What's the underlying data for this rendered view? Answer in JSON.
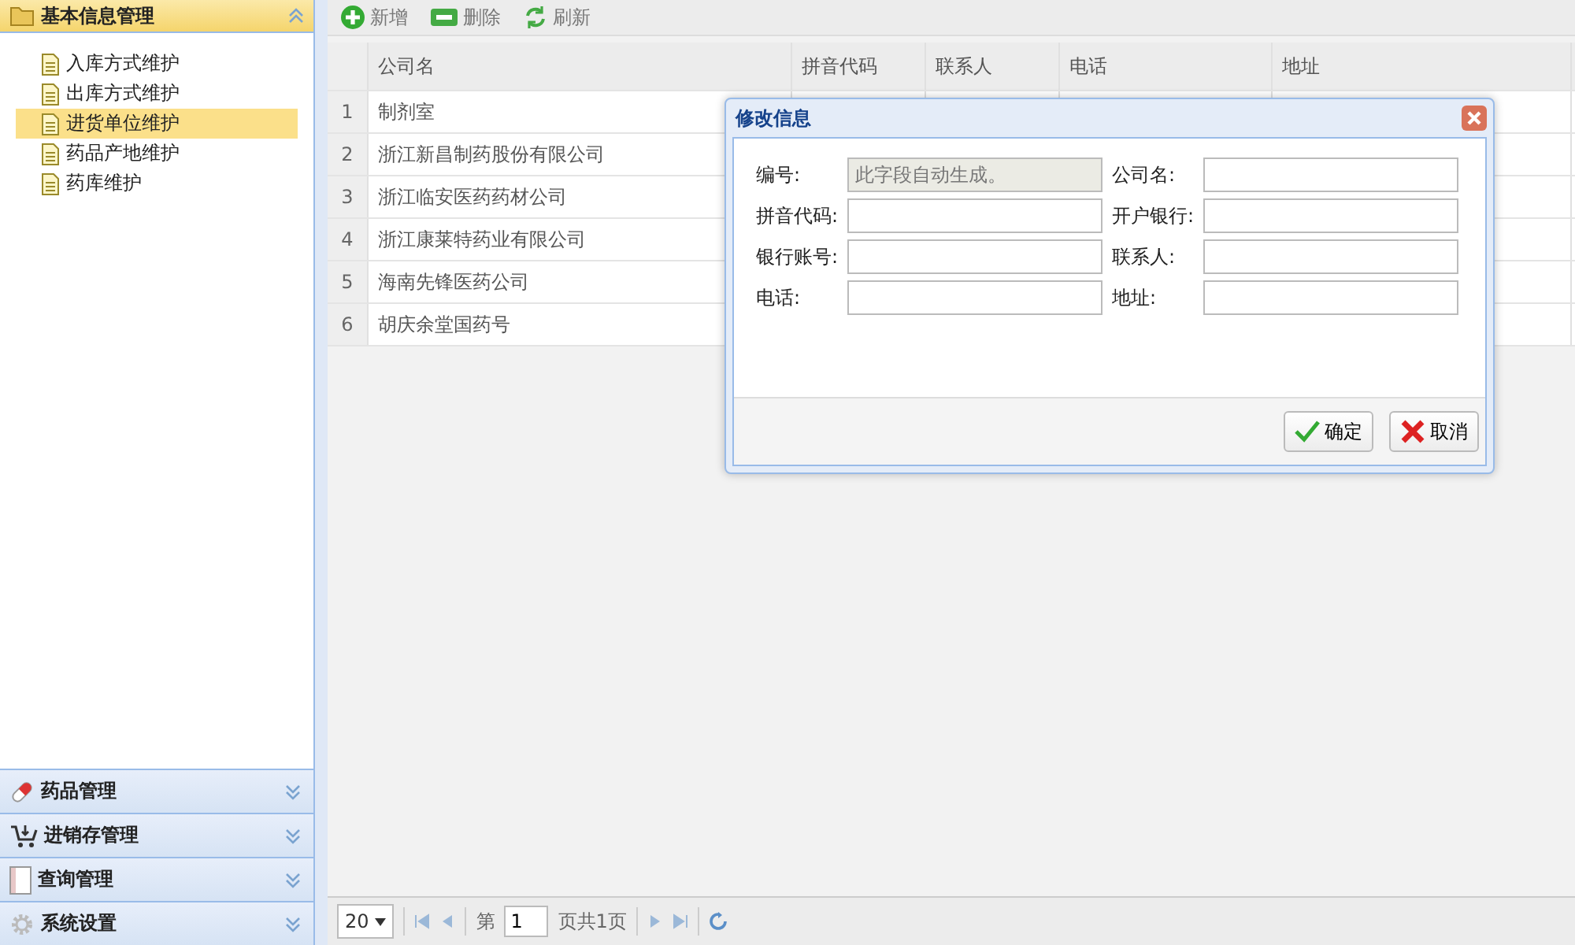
{
  "sidebar": {
    "header": {
      "title": "基本信息管理",
      "expanded": true
    },
    "items": [
      {
        "label": "入库方式维护",
        "selected": false
      },
      {
        "label": "出库方式维护",
        "selected": false
      },
      {
        "label": "进货单位维护",
        "selected": true
      },
      {
        "label": "药品产地维护",
        "selected": false
      },
      {
        "label": "药库维护",
        "selected": false
      }
    ],
    "panels": [
      {
        "label": "药品管理",
        "kind": "pill",
        "expanded": false
      },
      {
        "label": "进销存管理",
        "kind": "cart",
        "expanded": false
      },
      {
        "label": "查询管理",
        "kind": "book",
        "expanded": false
      },
      {
        "label": "系统设置",
        "kind": "gear",
        "expanded": false
      }
    ]
  },
  "toolbar": [
    {
      "label": "新增",
      "kind": "add"
    },
    {
      "label": "删除",
      "kind": "remove"
    },
    {
      "label": "刷新",
      "kind": "refresh"
    }
  ],
  "table": {
    "columns": [
      "公司名",
      "拼音代码",
      "联系人",
      "电话",
      "地址"
    ],
    "rows": [
      {
        "number": "1",
        "company": "制剂室"
      },
      {
        "number": "2",
        "company": "浙江新昌制药股份有限公司"
      },
      {
        "number": "3",
        "company": "浙江临安医药药材公司"
      },
      {
        "number": "4",
        "company": "浙江康莱特药业有限公司"
      },
      {
        "number": "5",
        "company": "海南先锋医药公司"
      },
      {
        "number": "6",
        "company": "胡庆余堂国药号"
      }
    ]
  },
  "pager": {
    "page_size": "20",
    "page_before": "第",
    "page": "1",
    "page_after": "页共1页"
  },
  "dialog": {
    "title": "修改信息",
    "fields": [
      {
        "label": "编号:",
        "value": "此字段自动生成。",
        "disabled": true
      },
      {
        "label": "公司名:",
        "disabled": false
      },
      {
        "label": "拼音代码:",
        "disabled": false
      },
      {
        "label": "开户银行:",
        "disabled": false
      },
      {
        "label": "银行账号:",
        "disabled": false
      },
      {
        "label": "联系人:",
        "disabled": false
      },
      {
        "label": "电话:",
        "disabled": false
      },
      {
        "label": "地址:",
        "disabled": false
      }
    ],
    "buttons": [
      {
        "label": "确定",
        "kind": "ok"
      },
      {
        "label": "取消",
        "kind": "cancel"
      }
    ]
  }
}
